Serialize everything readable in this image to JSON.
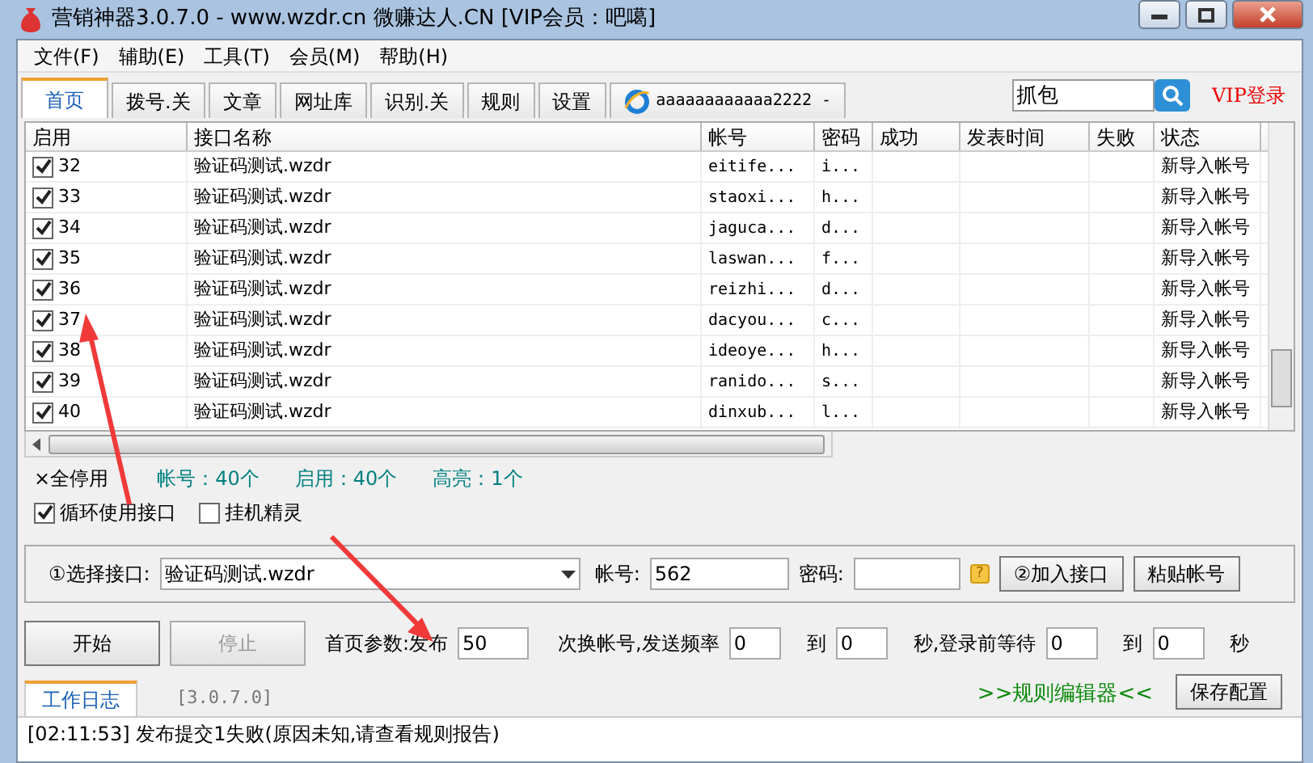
{
  "window": {
    "title": "营销神器3.0.7.0 - www.wzdr.cn 微赚达人.CN [VIP会员：吧噶]"
  },
  "menu": [
    {
      "label": "文件(F)"
    },
    {
      "label": "辅助(E)"
    },
    {
      "label": "工具(T)"
    },
    {
      "label": "会员(M)"
    },
    {
      "label": "帮助(H)"
    }
  ],
  "tabs": [
    {
      "label": "首页",
      "selected": true,
      "kind": "page"
    },
    {
      "label": "拨号.关",
      "selected": false,
      "kind": "page"
    },
    {
      "label": "文章",
      "selected": false,
      "kind": "page"
    },
    {
      "label": "网址库",
      "selected": false,
      "kind": "page"
    },
    {
      "label": "识别.关",
      "selected": false,
      "kind": "page"
    },
    {
      "label": "规则",
      "selected": false,
      "kind": "page"
    },
    {
      "label": "设置",
      "selected": false,
      "kind": "page"
    },
    {
      "label": "aaaaaaaaaaaa2222 -",
      "selected": false,
      "kind": "browser"
    }
  ],
  "search": {
    "value": "抓包"
  },
  "vip_login": "VIP登录",
  "table": {
    "columns": [
      "启用",
      "接口名称",
      "帐号",
      "密码",
      "成功",
      "发表时间",
      "失败",
      "状态"
    ],
    "rows": [
      {
        "checked": true,
        "id": "32",
        "interface": "验证码测试.wzdr",
        "account": "eitife...",
        "password": "i...",
        "status": "新导入帐号"
      },
      {
        "checked": true,
        "id": "33",
        "interface": "验证码测试.wzdr",
        "account": "staoxi...",
        "password": "h...",
        "status": "新导入帐号"
      },
      {
        "checked": true,
        "id": "34",
        "interface": "验证码测试.wzdr",
        "account": "jaguca...",
        "password": "d...",
        "status": "新导入帐号"
      },
      {
        "checked": true,
        "id": "35",
        "interface": "验证码测试.wzdr",
        "account": "laswan...",
        "password": "f...",
        "status": "新导入帐号"
      },
      {
        "checked": true,
        "id": "36",
        "interface": "验证码测试.wzdr",
        "account": "reizhi...",
        "password": "d...",
        "status": "新导入帐号"
      },
      {
        "checked": true,
        "id": "37",
        "interface": "验证码测试.wzdr",
        "account": "dacyou...",
        "password": "c...",
        "status": "新导入帐号"
      },
      {
        "checked": true,
        "id": "38",
        "interface": "验证码测试.wzdr",
        "account": "ideoye...",
        "password": "h...",
        "status": "新导入帐号"
      },
      {
        "checked": true,
        "id": "39",
        "interface": "验证码测试.wzdr",
        "account": "ranido...",
        "password": "s...",
        "status": "新导入帐号"
      },
      {
        "checked": true,
        "id": "40",
        "interface": "验证码测试.wzdr",
        "account": "dinxub...",
        "password": "l...",
        "status": "新导入帐号"
      }
    ]
  },
  "stats": {
    "stop_all": "×全停用",
    "accounts": "帐号：40个",
    "enabled": "启用：40个",
    "highlighted": "高亮：1个"
  },
  "options": [
    {
      "label": "循环使用接口",
      "checked": true
    },
    {
      "label": "挂机精灵",
      "checked": false
    }
  ],
  "interface_panel": {
    "select_label": "①选择接口:",
    "select_value": "验证码测试.wzdr",
    "account_label": "帐号:",
    "account_value": "562",
    "password_label": "密码:",
    "help_mark": "?",
    "add_button": "②加入接口",
    "paste_button": "粘贴帐号"
  },
  "run": {
    "start": {
      "label": "开始",
      "disabled": false
    },
    "stop": {
      "label": "停止",
      "disabled": true
    },
    "param_label": "首页参数:发布",
    "param_value": "50",
    "parts": [
      {
        "kind": "text",
        "text": "次换帐号,发送频率"
      },
      {
        "kind": "field",
        "value": "0"
      },
      {
        "kind": "text",
        "text": "到"
      },
      {
        "kind": "field",
        "value": "0"
      },
      {
        "kind": "text",
        "text": "秒,登录前等待"
      },
      {
        "kind": "field",
        "value": "0"
      },
      {
        "kind": "text",
        "text": "到"
      },
      {
        "kind": "field",
        "value": "0"
      },
      {
        "kind": "text",
        "text": "秒"
      }
    ]
  },
  "log_tabs": [
    {
      "label": "工作日志",
      "selected": true
    },
    {
      "label": "[3.0.7.0]",
      "selected": false
    }
  ],
  "rules_editor": ">>规则编辑器<<",
  "save_button": "保存配置",
  "log": [
    "[02:11:53] 发布提交1失败(原因未知,请查看规则报告)"
  ]
}
